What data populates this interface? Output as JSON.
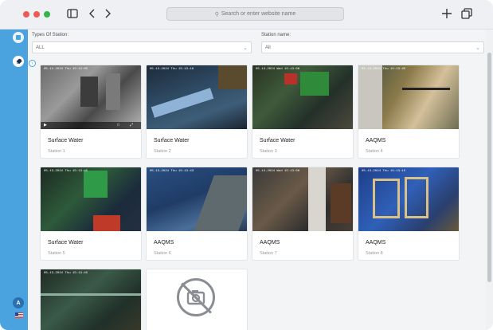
{
  "browser": {
    "url_placeholder": "Search or enter website name",
    "icons": [
      "sidebar-toggle-icon",
      "back-icon",
      "forward-icon",
      "new-tab-icon",
      "tabs-overview-icon",
      "search-icon"
    ]
  },
  "sidebar": {
    "avatar_initial": "A",
    "icons": [
      "home-icon",
      "rocket-icon",
      "us-flag-icon"
    ],
    "accent": "#4aa3df"
  },
  "filters": {
    "type_label": "Types Of Station:",
    "type_value": "ALL",
    "station_label": "Station name:",
    "station_value": "All"
  },
  "stations": [
    {
      "title": "Surface Water",
      "subtitle": "Station 1",
      "timestamp": "05-13-2024 Thu 15:13:05"
    },
    {
      "title": "Surface Water",
      "subtitle": "Station 2",
      "timestamp": "05-13-2024 Thu 15:13:16"
    },
    {
      "title": "Surface Water",
      "subtitle": "Station 3",
      "timestamp": "05-13-2024 Wed 15:13:08"
    },
    {
      "title": "AAQMS",
      "subtitle": "Station 4",
      "timestamp": "05-13-2024 Thu 15:13:45"
    },
    {
      "title": "Surface Water",
      "subtitle": "Station 5",
      "timestamp": "05-13-2024 Thu 15:13:45"
    },
    {
      "title": "AAQMS",
      "subtitle": "Station 6",
      "timestamp": "05-13-2024 Thu 15:13:43"
    },
    {
      "title": "AAQMS",
      "subtitle": "Station 7",
      "timestamp": "05-13-2024 Wed 15:13:08"
    },
    {
      "title": "AAQMS",
      "subtitle": "Station 8",
      "timestamp": "05-13-2024 Thu 15:13:15"
    },
    {
      "title": "",
      "subtitle": "",
      "timestamp": "05-13-2024 Thu 15:13:45"
    }
  ],
  "no_image_icon": "no-camera-icon"
}
